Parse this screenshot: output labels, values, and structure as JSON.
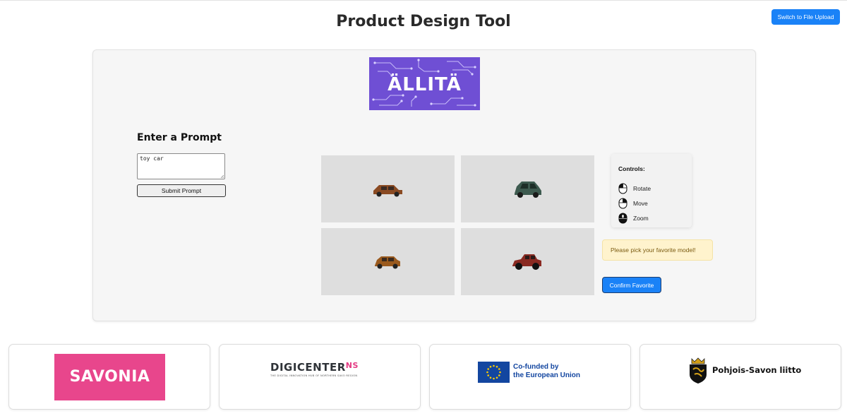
{
  "header": {
    "title": "Product Design Tool",
    "switch_button": "Switch to File Upload"
  },
  "brand": {
    "logo_text": "ÄLLITÄ",
    "color": "#6f4fd4"
  },
  "prompt": {
    "heading": "Enter a Prompt",
    "input_value": "toy car",
    "submit_label": "Submit Prompt"
  },
  "models": {
    "items": [
      {
        "icon": "car-model-icon",
        "color": "#8a4a22"
      },
      {
        "icon": "car-model-icon",
        "color": "#3d5a4f"
      },
      {
        "icon": "car-model-icon",
        "color": "#9a5a1e"
      },
      {
        "icon": "car-model-icon",
        "color": "#8a2a22"
      }
    ]
  },
  "controls": {
    "title": "Controls:",
    "items": [
      {
        "label": "Rotate",
        "icon": "mouse-left-icon"
      },
      {
        "label": "Move",
        "icon": "mouse-right-icon"
      },
      {
        "label": "Zoom",
        "icon": "mouse-wheel-icon"
      }
    ]
  },
  "status": {
    "pick_message": "Please pick your favorite model!"
  },
  "actions": {
    "confirm_label": "Confirm Favorite"
  },
  "partners": {
    "savonia": "SAVONIA",
    "digicenter": {
      "main": "DIGICENTER",
      "suffix": "NS",
      "sub": "THE DIGITAL INNOVATION HUB OF NORTHERN SAVO REGION"
    },
    "eu": {
      "line1": "Co-funded by",
      "line2": "the European Union"
    },
    "pohjois_savo": "Pohjois-Savon liitto"
  },
  "colors": {
    "accent": "#1a82f7",
    "savonia": "#e8468c",
    "eu_blue": "#1346a0",
    "warning_bg": "#fff3cd"
  }
}
